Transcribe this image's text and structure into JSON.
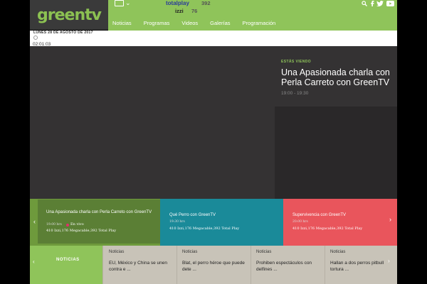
{
  "header": {
    "logo": "greentv",
    "nav": [
      "Noticias",
      "Programas",
      "Videos",
      "Galerías",
      "Programación"
    ],
    "providers": {
      "totalplay": "totalplay",
      "totalplay_channel": "392",
      "izzi": "izzi",
      "izzi_channel": "76"
    },
    "social_icons": [
      "search-icon",
      "facebook-icon",
      "twitter-icon",
      "youtube-icon"
    ]
  },
  "date": "LUNES 28 DE AGOSTO DE 2017",
  "clock": "02:01:03",
  "now_playing": {
    "label": "ESTÁS VIENDO",
    "title": "Una Apasionada charla con Perla Carreto con GreenTV",
    "time": "19:00 - 19:30"
  },
  "schedule_cards": [
    {
      "title": "Una Apasionada charla con Perla Carreto con GreenTV",
      "time": "19:00 hrs",
      "live": "En vivo",
      "channels": "410 Izzi,176 Megacable,392 Total Play"
    },
    {
      "title": "Qué Perro con GreenTV",
      "time": "19:30 hrs",
      "channels": "410 Izzi,176 Megacable,392 Total Play"
    },
    {
      "title": "Supervivencia con GreenTV",
      "time": "20:00 hrs",
      "channels": "410 Izzi,176 Megacable,392 Total Play"
    }
  ],
  "news": {
    "label": "NOTICIAS",
    "items": [
      {
        "category": "Noticias",
        "title": "EU, México y China se unen contra e ..."
      },
      {
        "category": "Noticias",
        "title": "Blat, el perro héroe que puede dete ..."
      },
      {
        "category": "Noticias",
        "title": "Prohiben espectáculos con delfines ..."
      },
      {
        "category": "Noticias",
        "title": "Hallan a dos perros pitbull tortura ..."
      }
    ]
  },
  "colors": {
    "brand_green": "#8fc45a",
    "card_teal": "#1a8a99",
    "card_red": "#e9555c"
  }
}
